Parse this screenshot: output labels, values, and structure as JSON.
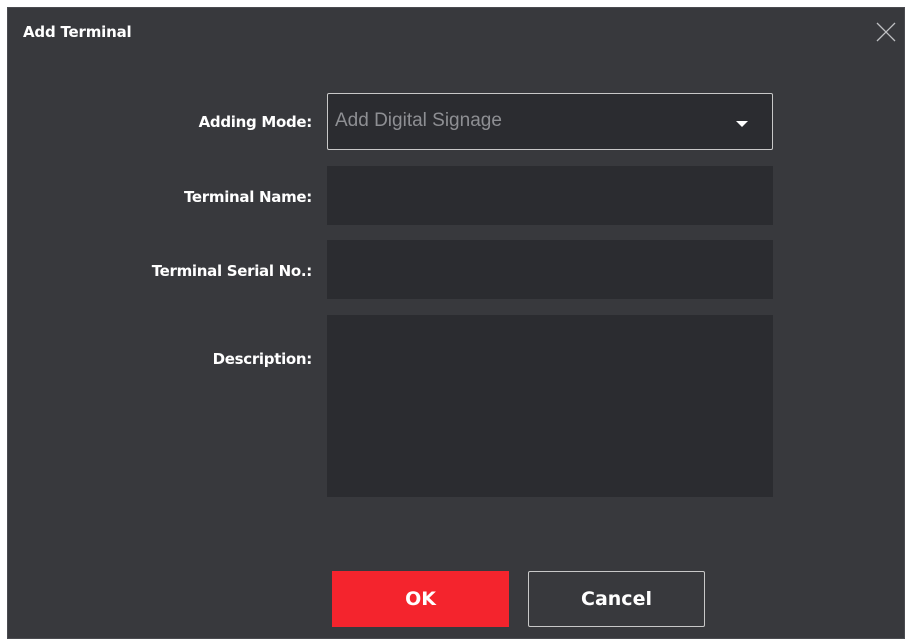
{
  "dialog": {
    "title": "Add Terminal",
    "close_icon": "close-icon"
  },
  "form": {
    "adding_mode": {
      "label": "Adding Mode:",
      "value": "Add Digital Signage",
      "caret_icon": "caret-down-icon"
    },
    "terminal_name": {
      "label": "Terminal Name:",
      "value": ""
    },
    "terminal_serial": {
      "label": "Terminal Serial No.:",
      "value": ""
    },
    "description": {
      "label": "Description:",
      "value": ""
    }
  },
  "buttons": {
    "ok_label": "OK",
    "cancel_label": "Cancel"
  },
  "colors": {
    "background": "#38393d",
    "field_background": "#2b2c30",
    "accent": "#f4242d",
    "text": "#ffffff"
  }
}
